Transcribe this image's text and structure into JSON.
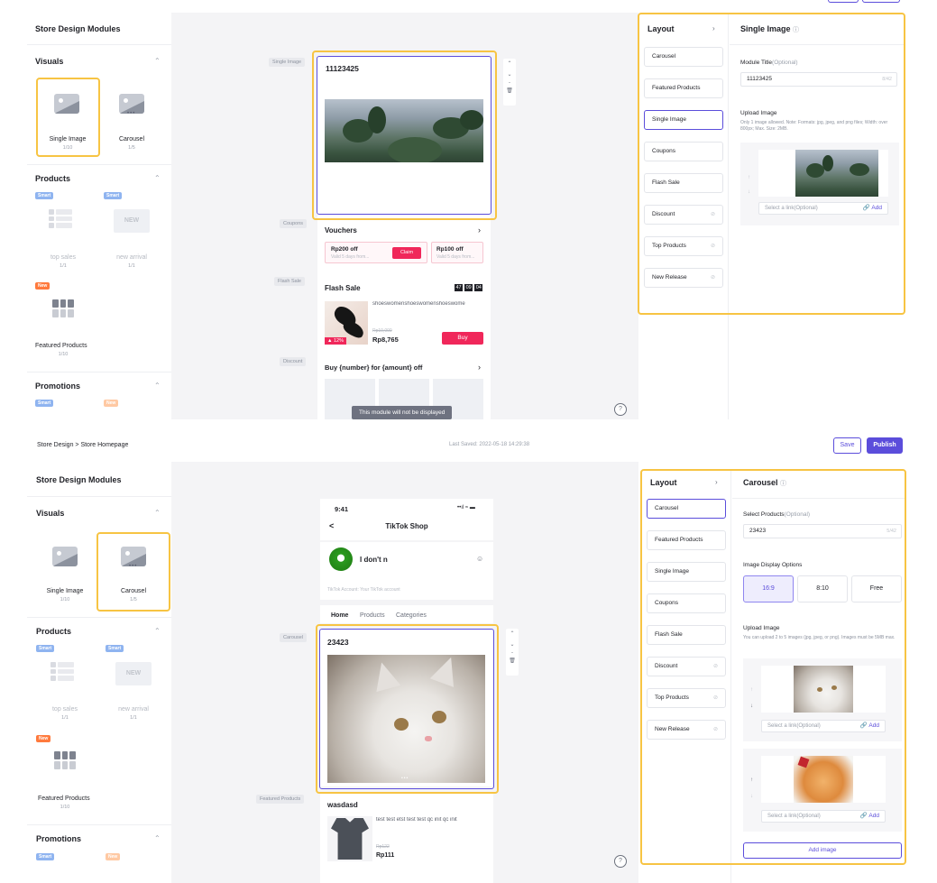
{
  "colors": {
    "accent": "#5b4ddb",
    "highlight": "#f7c443",
    "sale": "#f0275a",
    "badge_new": "#ff7a3d",
    "badge_smart": "#8fb4f0"
  },
  "top": {
    "modules_title": "Store Design Modules",
    "visuals": "Visuals",
    "visual_cards": [
      {
        "label": "Single Image",
        "count": "1/10"
      },
      {
        "label": "Carousel",
        "count": "1/5"
      }
    ],
    "products": "Products",
    "badge_smart": "Smart",
    "badge_new": "New",
    "product_cards": [
      {
        "label": "top sales",
        "count": "1/1"
      },
      {
        "label": "new arrival",
        "count": "1/1"
      }
    ],
    "new_icon_text": "NEW",
    "featured": {
      "label": "Featured Products",
      "count": "1/10"
    },
    "promotions": "Promotions",
    "canvas_tags": {
      "single_image": "Single Image",
      "coupons": "Coupons",
      "flash_sale": "Flash Sale",
      "discount": "Discount"
    },
    "module_title_value": "11123425",
    "vouchers": {
      "title": "Vouchers",
      "v1_title": "Rp200 off",
      "v1_sub": "Valid 5 days from...",
      "claim": "Claim",
      "v2_title": "Rp100 off",
      "v2_sub": "Valid 5 days from..."
    },
    "flash": {
      "title": "Flash Sale",
      "h": "47",
      "m": "09",
      "s": "04",
      "product_name": "shoeswomenshoeswomenshoeswome",
      "discount": "12%",
      "old_price": "Rp10,000",
      "price": "Rp8,765",
      "buy": "Buy"
    },
    "discount_title": "Buy {number} for {amount} off",
    "tooltip": "This module will not be displayed",
    "layout_title": "Layout",
    "layout_items": [
      "Carousel",
      "Featured Products",
      "Single Image",
      "Coupons",
      "Flash Sale",
      "Discount",
      "Top Products",
      "New Release"
    ],
    "settings_title": "Single Image",
    "module_title_label": "Module Title",
    "optional": "(Optional)",
    "title_counter": "8/42",
    "upload_label": "Upload Image",
    "upload_note": "Only 1 image allowed. Note: Formats: jpg, jpeg, and png files; Width: over 800px; Max. Size: 2MB.",
    "link_placeholder": "Select a link(Optional)",
    "add": "Add"
  },
  "bottom": {
    "breadcrumb": "Store Design > Store Homepage",
    "last_saved": "Last Saved: 2022-05-18 14:29:38",
    "save": "Save",
    "publish": "Publish",
    "modules_title": "Store Design Modules",
    "visuals": "Visuals",
    "visual_cards": [
      {
        "label": "Single Image",
        "count": "1/10"
      },
      {
        "label": "Carousel",
        "count": "1/5"
      }
    ],
    "products": "Products",
    "badge_smart": "Smart",
    "badge_new": "New",
    "product_cards": [
      {
        "label": "top sales",
        "count": "1/1"
      },
      {
        "label": "new arrival",
        "count": "1/1"
      }
    ],
    "new_icon_text": "NEW",
    "featured": {
      "label": "Featured Products",
      "count": "1/10"
    },
    "promotions": "Promotions",
    "phone": {
      "time": "9:41",
      "signal": "••ıl ≈ ▬",
      "back": "<",
      "shop_title": "TikTok Shop",
      "shop_name": "I don't n",
      "account_note": "TikTok Account: Your TikTok account",
      "tabs": [
        "Home",
        "Products",
        "Categories"
      ]
    },
    "canvas_tags": {
      "carousel": "Carousel",
      "featured": "Featured Products"
    },
    "carousel_title_value": "23423",
    "featured_block": {
      "title": "wasdasd",
      "product_name": "test test etst test test qc init qc init",
      "old_price": "Rp122",
      "price": "Rp111"
    },
    "layout_title": "Layout",
    "layout_items": [
      "Carousel",
      "Featured Products",
      "Single Image",
      "Coupons",
      "Flash Sale",
      "Discount",
      "Top Products",
      "New Release"
    ],
    "settings_title": "Carousel",
    "select_products_label": "Select Products",
    "optional": "(Optional)",
    "select_value": "23423",
    "select_counter": "5/42",
    "display_options_label": "Image Display Options",
    "display_options": [
      "16:9",
      "8:10",
      "Free"
    ],
    "upload_label": "Upload Image",
    "upload_note": "You can upload 2 to 5 images (jpg, jpeg, or png). Images must be 5MB max.",
    "link_placeholder": "Select a link(Optional)",
    "add": "Add",
    "add_image": "Add image"
  }
}
